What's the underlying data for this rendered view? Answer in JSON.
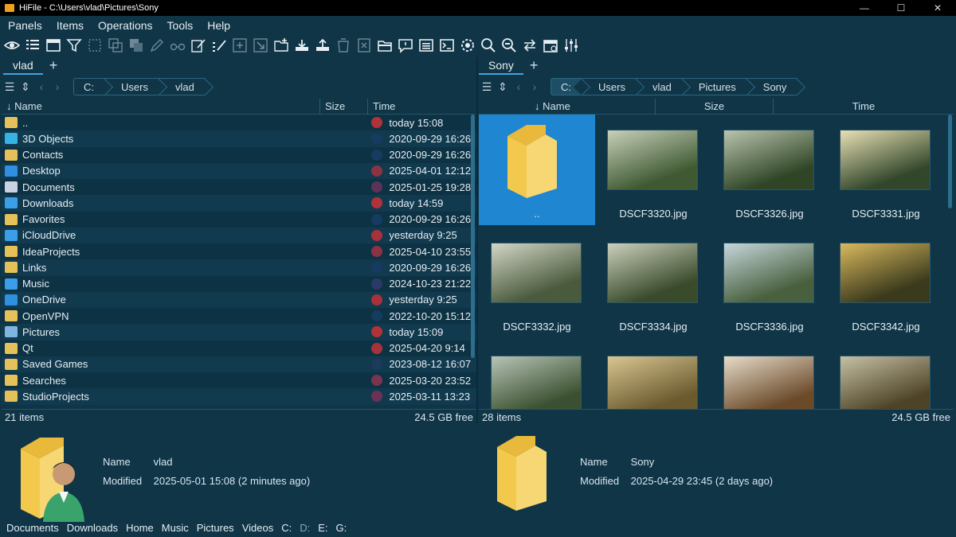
{
  "window": {
    "title": "HiFile - C:\\Users\\vlad\\Pictures\\Sony",
    "min": "—",
    "max": "☐",
    "close": "✕"
  },
  "menu": [
    "Panels",
    "Items",
    "Operations",
    "Tools",
    "Help"
  ],
  "toolbar_icons": [
    "eye-icon",
    "list-icon",
    "panel-icon",
    "filter-icon",
    "select-icon",
    "copy-icon",
    "duplicate-icon",
    "pen-icon",
    "glasses-icon",
    "edit-icon",
    "edit-multi-icon",
    "add-icon",
    "move-icon",
    "new-folder-icon",
    "download-icon",
    "upload-icon",
    "trash-icon",
    "delete-icon",
    "open-folder-icon",
    "comment-icon",
    "window-icon",
    "terminal-icon",
    "settings-icon",
    "search-icon",
    "zoom-icon",
    "swap-icon",
    "calendar-icon",
    "sliders-icon"
  ],
  "left": {
    "tab": "vlad",
    "crumbs": [
      "C:",
      "Users",
      "vlad"
    ],
    "columns": {
      "name": "Name",
      "size": "Size",
      "time": "Time"
    },
    "rows": [
      {
        "name": "..",
        "time": "today 15:08",
        "icon": "#e6c15a",
        "dot": "#b2323a"
      },
      {
        "name": "3D Objects",
        "time": "2020-09-29 16:26",
        "icon": "#36b2e5",
        "dot": "#153b61"
      },
      {
        "name": "Contacts",
        "time": "2020-09-29 16:26",
        "icon": "#e6c15a",
        "dot": "#153b61"
      },
      {
        "name": "Desktop",
        "time": "2025-04-01 12:12",
        "icon": "#2f8fe0",
        "dot": "#8b3344"
      },
      {
        "name": "Documents",
        "time": "2025-01-25 19:28",
        "icon": "#c8d3df",
        "dot": "#5c3358"
      },
      {
        "name": "Downloads",
        "time": "today 14:59",
        "icon": "#3a9fe8",
        "dot": "#b2323a"
      },
      {
        "name": "Favorites",
        "time": "2020-09-29 16:26",
        "icon": "#e6c15a",
        "dot": "#153b61"
      },
      {
        "name": "iCloudDrive",
        "time": "yesterday 9:25",
        "icon": "#3a9fe8",
        "dot": "#a8323b"
      },
      {
        "name": "IdeaProjects",
        "time": "2025-04-10 23:55",
        "icon": "#e6c15a",
        "dot": "#8b3344"
      },
      {
        "name": "Links",
        "time": "2020-09-29 16:26",
        "icon": "#e6c15a",
        "dot": "#153b61"
      },
      {
        "name": "Music",
        "time": "2024-10-23 21:22",
        "icon": "#3a9fe8",
        "dot": "#2a3a66"
      },
      {
        "name": "OneDrive",
        "time": "yesterday 9:25",
        "icon": "#2f8fe0",
        "dot": "#a8323b"
      },
      {
        "name": "OpenVPN",
        "time": "2022-10-20 15:12",
        "icon": "#e6c15a",
        "dot": "#153b61"
      },
      {
        "name": "Pictures",
        "time": "today 15:09",
        "icon": "#7fb6e0",
        "dot": "#b2323a"
      },
      {
        "name": "Qt",
        "time": "2025-04-20 9:14",
        "icon": "#e6c15a",
        "dot": "#a8323b"
      },
      {
        "name": "Saved Games",
        "time": "2023-08-12 16:07",
        "icon": "#e6c15a",
        "dot": "#1c3a5a"
      },
      {
        "name": "Searches",
        "time": "2025-03-20 23:52",
        "icon": "#e6c15a",
        "dot": "#7a3450"
      },
      {
        "name": "StudioProjects",
        "time": "2025-03-11 13:23",
        "icon": "#e6c15a",
        "dot": "#6a3355"
      }
    ],
    "status_left": "21 items",
    "status_right": "24.5 GB free"
  },
  "right": {
    "tab": "Sony",
    "crumbs": [
      "C:",
      "Users",
      "vlad",
      "Pictures",
      "Sony"
    ],
    "columns": {
      "name": "Name",
      "size": "Size",
      "time": "Time"
    },
    "items": [
      {
        "label": "..",
        "kind": "folder"
      },
      {
        "label": "DSCF3320.jpg",
        "kind": "photo",
        "c1": "#c7d0b9",
        "c2": "#3f5a33"
      },
      {
        "label": "DSCF3326.jpg",
        "kind": "photo",
        "c1": "#b9c4ad",
        "c2": "#2f4526"
      },
      {
        "label": "DSCF3331.jpg",
        "kind": "photo",
        "c1": "#e8e0b4",
        "c2": "#31462a"
      },
      {
        "label": "DSCF3332.jpg",
        "kind": "photo",
        "c1": "#d2d6c6",
        "c2": "#4a5a3c"
      },
      {
        "label": "DSCF3334.jpg",
        "kind": "photo",
        "c1": "#cbd0bc",
        "c2": "#3a4b2c"
      },
      {
        "label": "DSCF3336.jpg",
        "kind": "photo",
        "c1": "#c6d6db",
        "c2": "#49603e"
      },
      {
        "label": "DSCF3342.jpg",
        "kind": "photo",
        "c1": "#d9b95e",
        "c2": "#3a3a1c"
      },
      {
        "label": "",
        "kind": "photo",
        "c1": "#b7c4b6",
        "c2": "#3b5030"
      },
      {
        "label": "",
        "kind": "photo",
        "c1": "#d8c692",
        "c2": "#6b5a2e"
      },
      {
        "label": "",
        "kind": "photo",
        "c1": "#e6dcc9",
        "c2": "#6b4a2a"
      },
      {
        "label": "",
        "kind": "photo",
        "c1": "#c6c1a4",
        "c2": "#4e4326"
      }
    ],
    "status_left": "28 items",
    "status_right": "24.5 GB free"
  },
  "info_left": {
    "name_key": "Name",
    "name_val": "vlad",
    "mod_key": "Modified",
    "mod_val": "2025-05-01 15:08 (2 minutes ago)"
  },
  "info_right": {
    "name_key": "Name",
    "name_val": "Sony",
    "mod_key": "Modified",
    "mod_val": "2025-04-29 23:45 (2 days ago)"
  },
  "favorites": [
    {
      "label": "Documents",
      "dim": false
    },
    {
      "label": "Downloads",
      "dim": false
    },
    {
      "label": "Home",
      "dim": false
    },
    {
      "label": "Music",
      "dim": false
    },
    {
      "label": "Pictures",
      "dim": false
    },
    {
      "label": "Videos",
      "dim": false
    },
    {
      "label": "C:",
      "dim": false
    },
    {
      "label": "D:",
      "dim": true
    },
    {
      "label": "E:",
      "dim": false
    },
    {
      "label": "G:",
      "dim": false
    }
  ]
}
